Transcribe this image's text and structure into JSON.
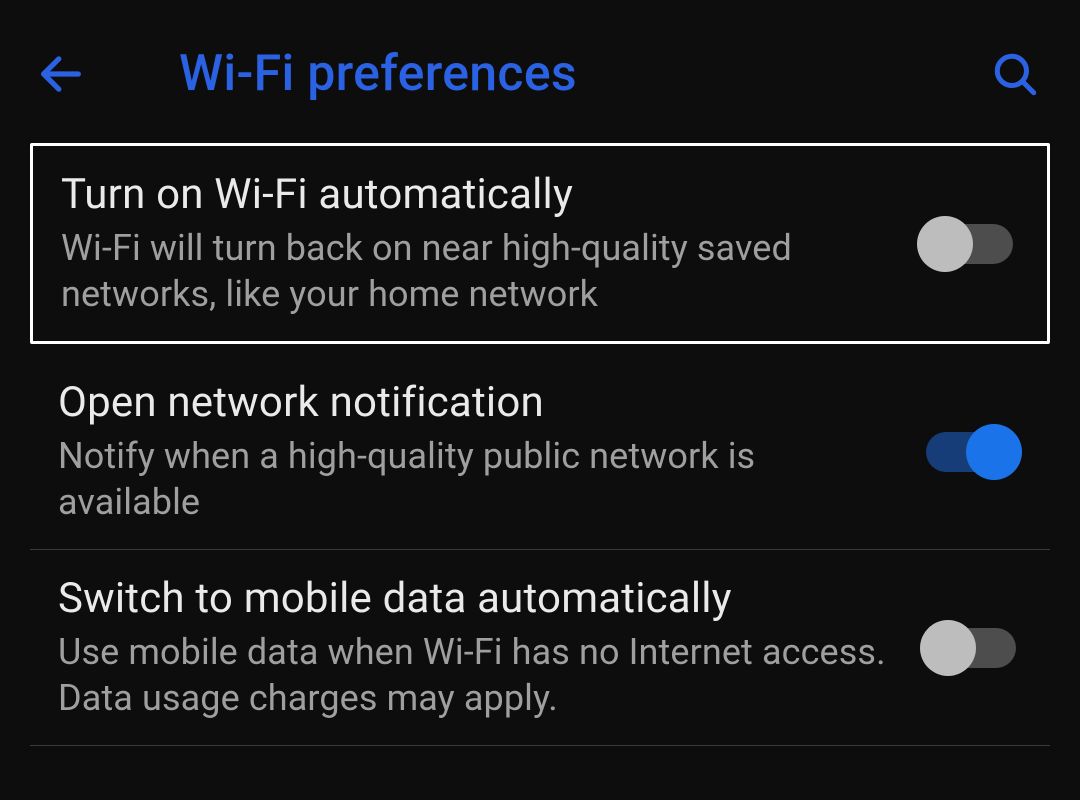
{
  "header": {
    "title": "Wi-Fi preferences"
  },
  "settings": [
    {
      "title": "Turn on Wi-Fi automatically",
      "description": "Wi-Fi will turn back on near high-quality saved networks, like your home network",
      "enabled": false,
      "highlighted": true
    },
    {
      "title": "Open network notification",
      "description": "Notify when a high-quality public network is available",
      "enabled": true,
      "highlighted": false
    },
    {
      "title": "Switch to mobile data automatically",
      "description": "Use mobile data when Wi-Fi has no Internet access. Data usage charges may apply.",
      "enabled": false,
      "highlighted": false
    }
  ]
}
